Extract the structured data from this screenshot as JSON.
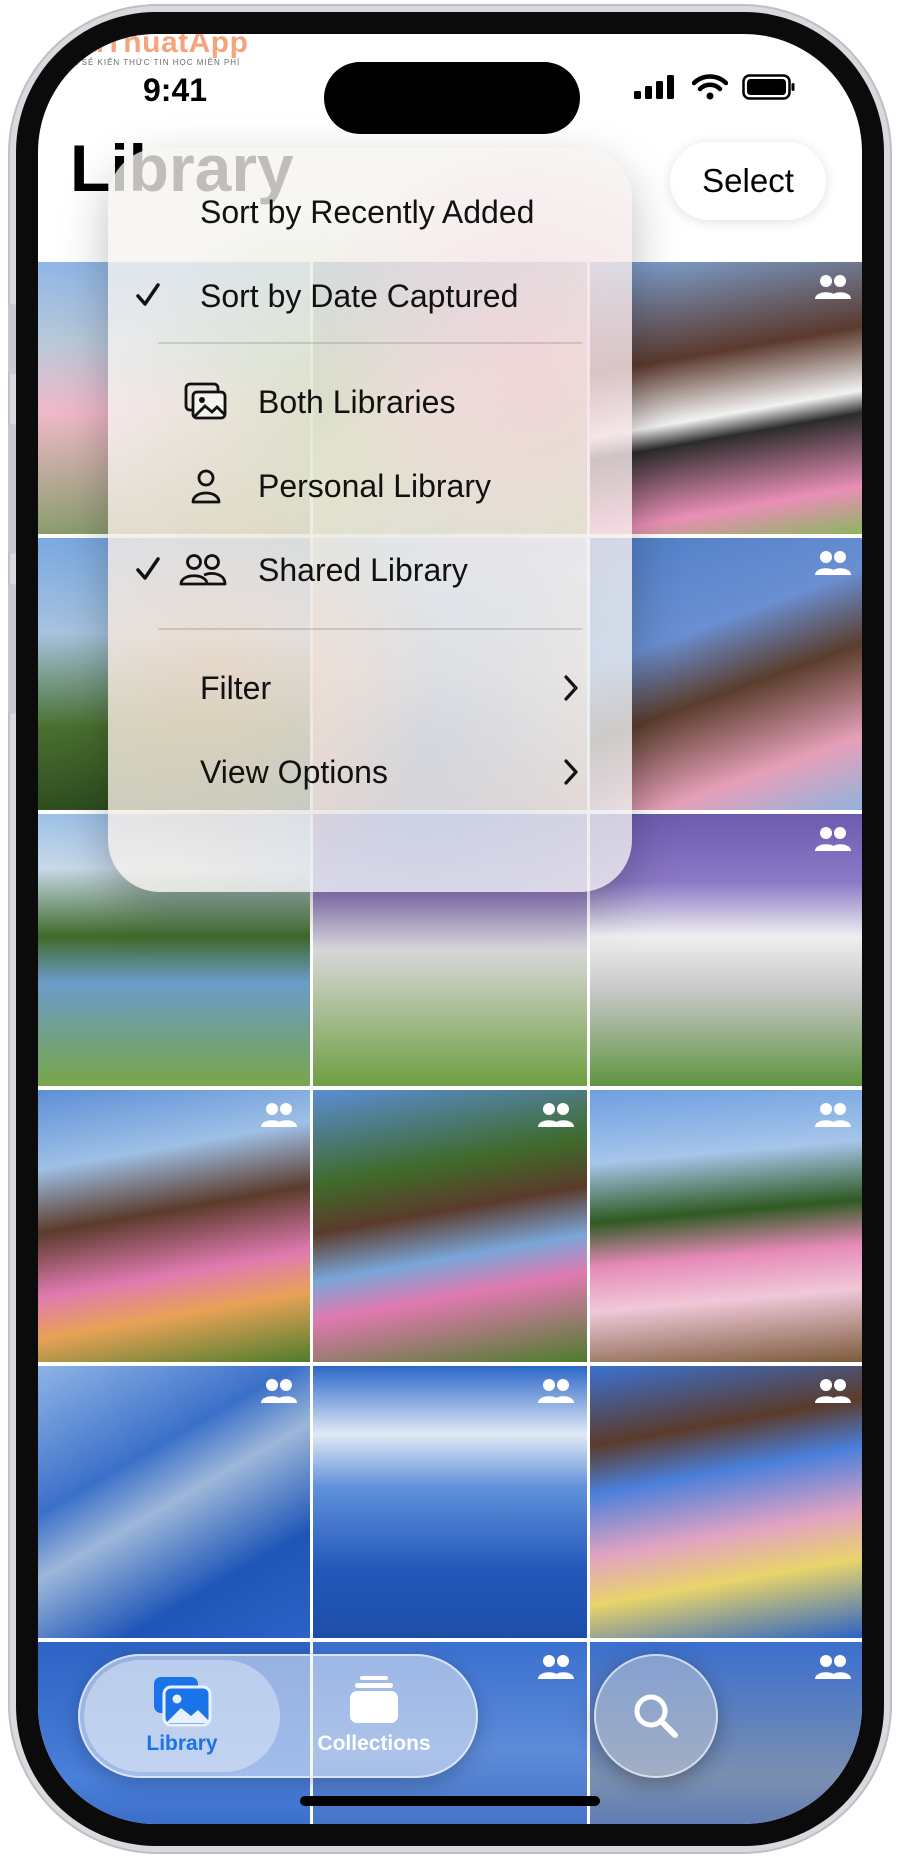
{
  "watermark": {
    "title": "ThuThuatApp",
    "subtitle": "CHIA SẺ KIẾN THỨC TIN HỌC MIỄN PHÍ"
  },
  "status_bar": {
    "time": "9:41"
  },
  "header": {
    "title": "Library",
    "select_label": "Select"
  },
  "menu": {
    "sort_items": [
      {
        "label": "Sort by Recently Added",
        "checked": false
      },
      {
        "label": "Sort by Date Captured",
        "checked": true
      }
    ],
    "library_items": [
      {
        "label": "Both Libraries",
        "icon": "photos-stack-icon",
        "checked": false
      },
      {
        "label": "Personal Library",
        "icon": "person-icon",
        "checked": false
      },
      {
        "label": "Shared Library",
        "icon": "people-icon",
        "checked": true
      }
    ],
    "more_items": [
      {
        "label": "Filter",
        "icon": "chevron-right-icon"
      },
      {
        "label": "View Options",
        "icon": "chevron-right-icon"
      }
    ]
  },
  "tab_bar": {
    "tabs": [
      {
        "label": "Library",
        "icon": "photos-library-icon",
        "active": true
      },
      {
        "label": "Collections",
        "icon": "collections-stack-icon",
        "active": false
      }
    ],
    "search_icon": "magnifying-glass-icon"
  },
  "colors": {
    "accent": "#1a73e8",
    "text": "#111111",
    "menu_bg": "#f6f4f0"
  }
}
